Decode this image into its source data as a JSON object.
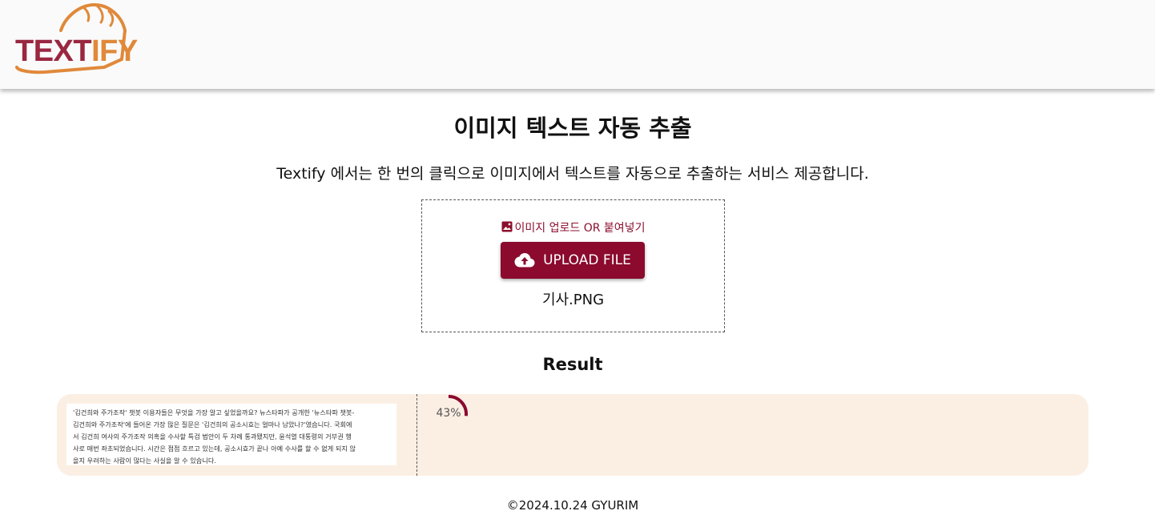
{
  "brand": {
    "logo_part1": "TEXT",
    "logo_part2": "IFY",
    "color_primary": "#9a2740",
    "color_secondary": "#e0893a"
  },
  "main": {
    "title": "이미지 텍스트 자동 추출",
    "subtitle": "Textify 에서는 한 번의 클릭으로 이미지에서 텍스트를 자동으로 추출하는 서비스 제공합니다."
  },
  "upload": {
    "hint_icon": "image-icon",
    "hint": "이미지 업로드 OR 붙여넣기",
    "button_icon": "cloud-upload-icon",
    "button_label": "UPLOAD FILE",
    "file_name": "기사.PNG",
    "accent_color": "#8b0a2e"
  },
  "result": {
    "heading": "Result",
    "image_lines": [
      "'김건희와 주가조작' 챗봇 이용자들은 무엇을 가장 알고 싶었을까요? 뉴스타파가 공개한 '뉴스타파 챗봇-",
      "김건희와 주가조작'에 들어온 가장 많은 질문은 '김건희의 공소시효는 얼마나 남았나?'였습니다. 국회에",
      "서 김건희 여사의 주가조작 의혹을 수사할 특검 법안이 두 차례 통과됐지만, 윤석열 대통령의 거부권 행",
      "사로 매번 좌초되었습니다. 시간은 점점 흐르고 있는데, 공소시효가 끝나 아예 수사를 할 수 없게 되지 않",
      "을지 우려하는 사람이 많다는 사실을 알 수 있습니다."
    ],
    "progress_value": 43,
    "progress_label": "43%",
    "panel_color": "#fbefe4"
  },
  "footer": {
    "copyright": "©2024.10.24 GYURIM"
  }
}
